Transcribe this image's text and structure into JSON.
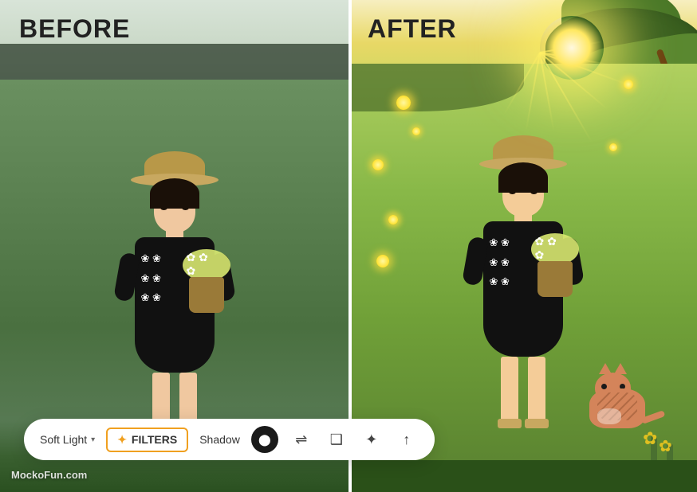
{
  "before": {
    "label": "BEFORE"
  },
  "after": {
    "label": "AFTER"
  },
  "watermark": {
    "text": "MockoFun.com"
  },
  "toolbar": {
    "soft_light_label": "Soft Light",
    "filters_label": "FILTERS",
    "shadow_label": "Shadow",
    "blend_icon": "⇌",
    "copy_icon": "⧉",
    "magic_icon": "✦",
    "upload_icon": "↑"
  }
}
